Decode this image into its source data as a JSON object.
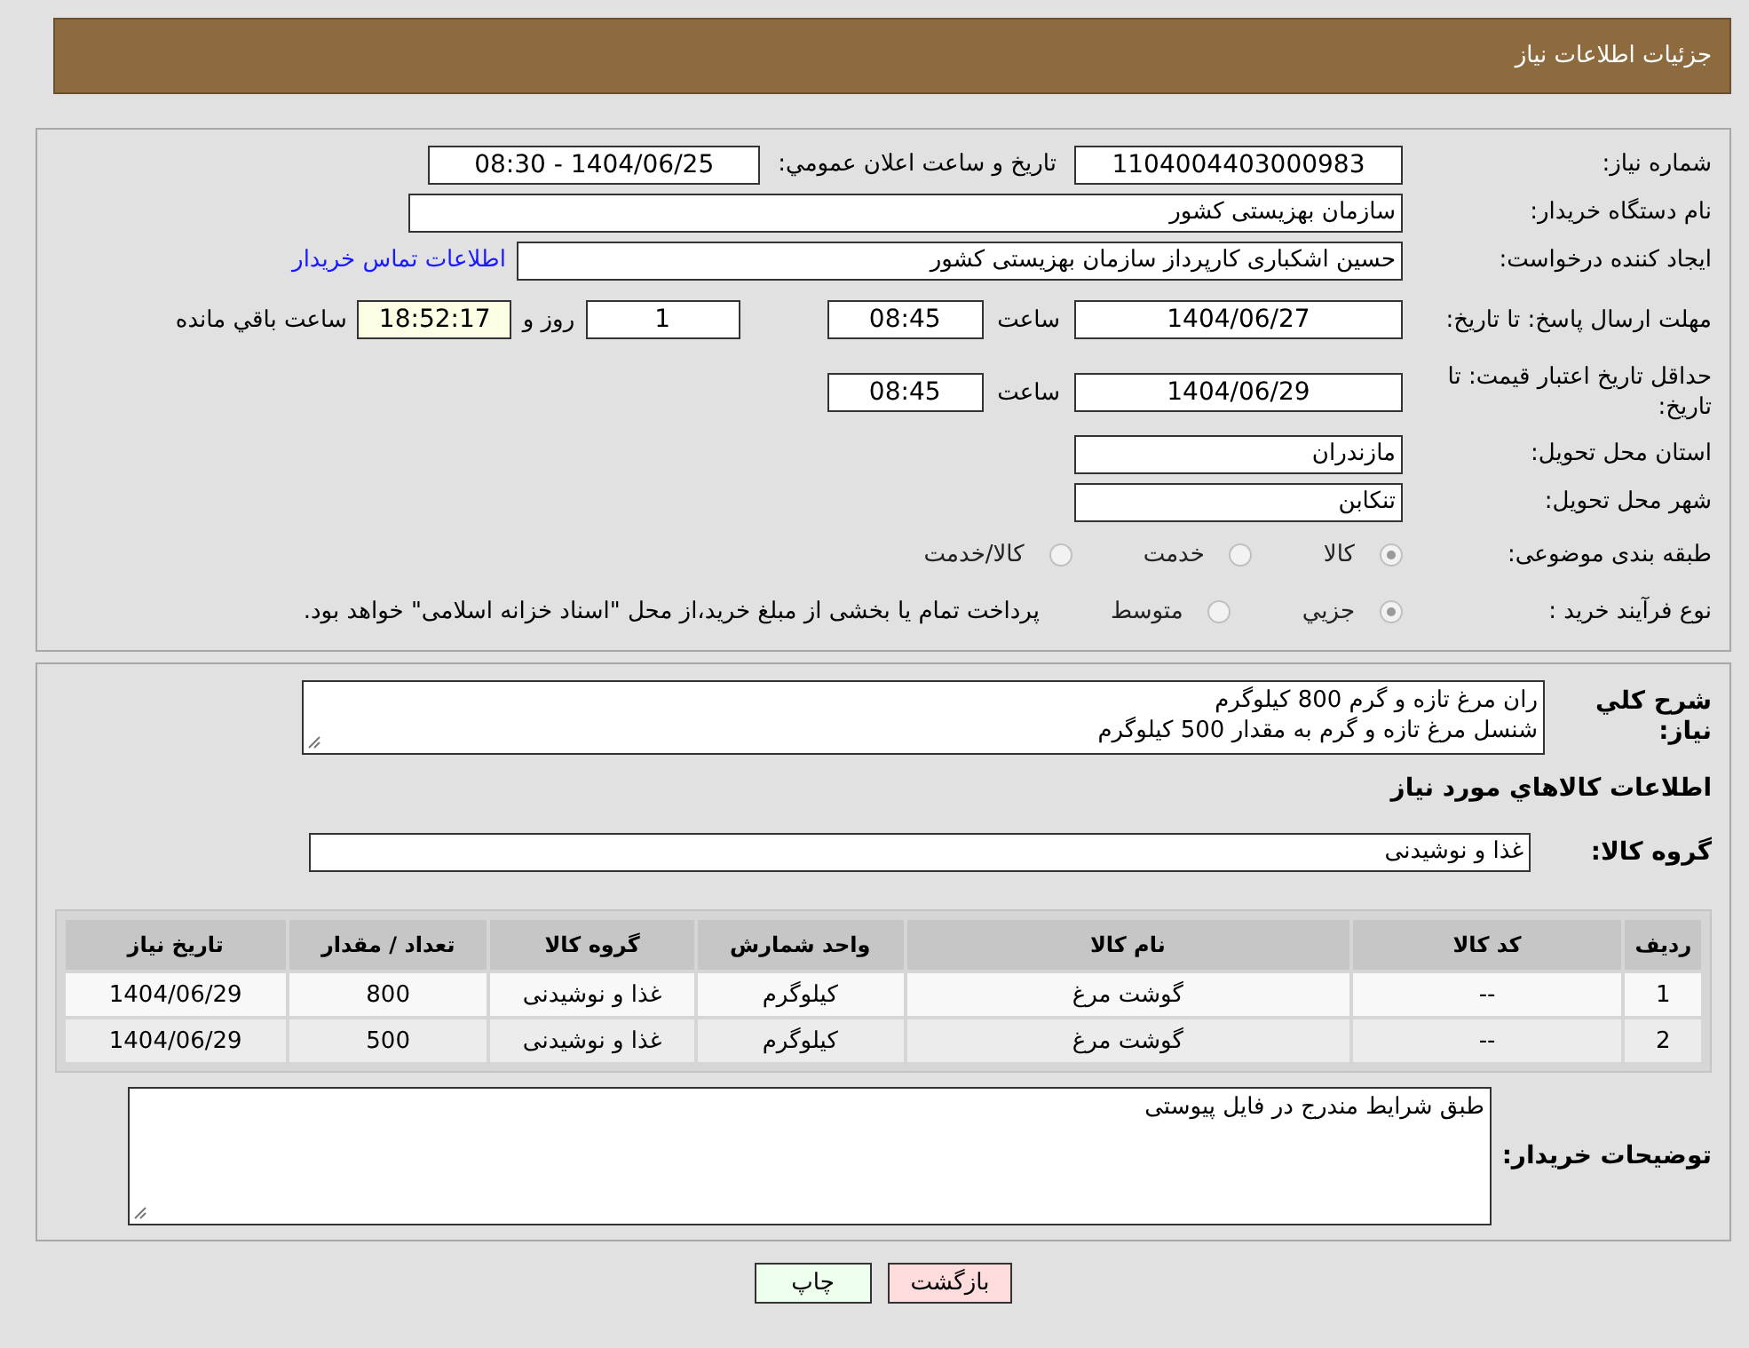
{
  "header": {
    "title": "جزئیات اطلاعات نیاز"
  },
  "need_number": {
    "label": "شماره نیاز:",
    "value": "1104004403000983"
  },
  "announce": {
    "label": "تاریخ و ساعت اعلان عمومي:",
    "value": "1404/06/25 - 08:30"
  },
  "buyer": {
    "label": "نام دستگاه خریدار:",
    "value": "سازمان بهزیستی کشور"
  },
  "creator": {
    "label": "ایجاد کننده درخواست:",
    "value": "حسین اشکباری کارپرداز سازمان بهزیستی کشور",
    "link": "اطلاعات تماس خریدار"
  },
  "reply_deadline": {
    "label": "مهلت ارسال پاسخ: تا تاریخ:",
    "date": "1404/06/27",
    "time_label": "ساعت",
    "time": "08:45",
    "days": "1",
    "days_label": "روز و",
    "remaining": "18:52:17",
    "remaining_label": "ساعت باقي مانده"
  },
  "price_validity": {
    "label": "حداقل تاریخ اعتبار قیمت: تا تاریخ:",
    "date": "1404/06/29",
    "time_label": "ساعت",
    "time": "08:45"
  },
  "province": {
    "label": "استان محل تحویل:",
    "value": "مازندران"
  },
  "city": {
    "label": "شهر محل تحویل:",
    "value": "تنکابن"
  },
  "category": {
    "label": "طبقه بندی موضوعی:",
    "options": [
      {
        "label": "کالا",
        "selected": true
      },
      {
        "label": "خدمت",
        "selected": false
      },
      {
        "label": "کالا/خدمت",
        "selected": false
      }
    ]
  },
  "purchase_type": {
    "label": "نوع فرآیند خرید :",
    "options": [
      {
        "label": "جزيي",
        "selected": true
      },
      {
        "label": "متوسط",
        "selected": false
      }
    ],
    "note": "پرداخت تمام یا بخشی از مبلغ خرید،از محل \"اسناد خزانه اسلامی\" خواهد بود."
  },
  "description": {
    "label": "شرح کلي نیاز:",
    "lines": [
      "ران مرغ تازه و گرم 800 کیلوگرم",
      "شنسل مرغ تازه و گرم به مقدار 500 کیلوگرم"
    ]
  },
  "items_heading": "اطلاعات کالاهاي مورد نیاز",
  "goods_group": {
    "label": "گروه کالا:",
    "value": "غذا و نوشیدنی"
  },
  "table": {
    "columns": [
      "ردیف",
      "کد کالا",
      "نام کالا",
      "واحد شمارش",
      "گروه کالا",
      "تعداد / مقدار",
      "تاریخ نیاز"
    ],
    "rows": [
      [
        "1",
        "--",
        "گوشت مرغ",
        "کیلوگرم",
        "غذا و نوشیدنی",
        "800",
        "1404/06/29"
      ],
      [
        "2",
        "--",
        "گوشت مرغ",
        "کیلوگرم",
        "غذا و نوشیدنی",
        "500",
        "1404/06/29"
      ]
    ]
  },
  "buyer_notes": {
    "label": "توضیحات خریدار:",
    "value": "طبق شرایط مندرج در فایل پیوستی"
  },
  "buttons": [
    {
      "label": "بازگشت",
      "kind": "back"
    },
    {
      "label": "چاپ",
      "kind": "print"
    }
  ]
}
